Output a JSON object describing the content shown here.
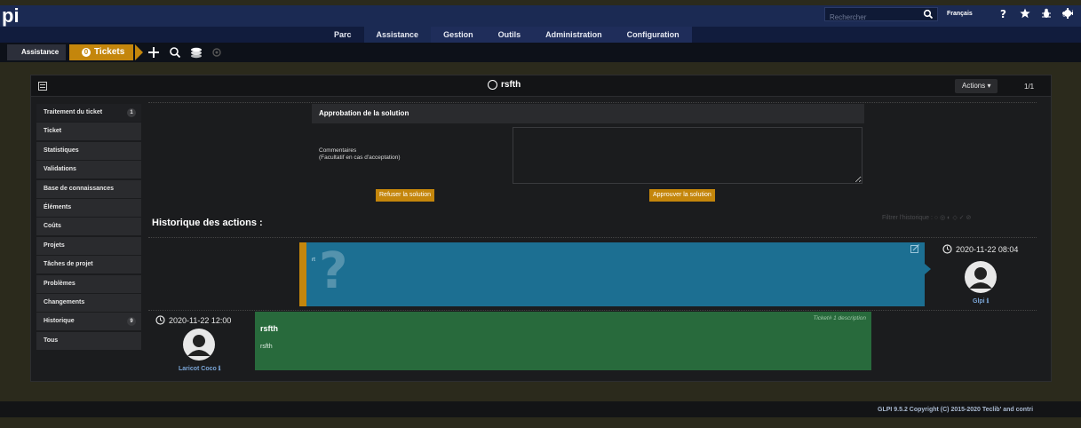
{
  "app": {
    "logo": "pi",
    "user": "glpi",
    "language": "Français"
  },
  "search": {
    "placeholder": "Rechercher"
  },
  "menu": {
    "items": [
      "Parc",
      "Assistance",
      "Gestion",
      "Outils",
      "Administration",
      "Configuration"
    ]
  },
  "breadcrumb": {
    "section": "Assistance",
    "page": "Tickets",
    "page_number": "0"
  },
  "card": {
    "title": "rsfth",
    "actions_label": "Actions",
    "pager": "1/1"
  },
  "tabs": [
    {
      "label": "Traitement du ticket",
      "badge": "1"
    },
    {
      "label": "Ticket",
      "badge": ""
    },
    {
      "label": "Statistiques",
      "badge": ""
    },
    {
      "label": "Validations",
      "badge": ""
    },
    {
      "label": "Base de connaissances",
      "badge": ""
    },
    {
      "label": "Éléments",
      "badge": ""
    },
    {
      "label": "Coûts",
      "badge": ""
    },
    {
      "label": "Projets",
      "badge": ""
    },
    {
      "label": "Tâches de projet",
      "badge": ""
    },
    {
      "label": "Problèmes",
      "badge": ""
    },
    {
      "label": "Changements",
      "badge": ""
    },
    {
      "label": "Historique",
      "badge": "9"
    },
    {
      "label": "Tous",
      "badge": ""
    }
  ],
  "approval": {
    "title": "Approbation de la solution",
    "comment_label_1": "Commentaires",
    "comment_label_2": "(Facultatif en cas d'acceptation)",
    "refuse_label": "Refuser la solution",
    "approve_label": "Approuver la solution"
  },
  "history": {
    "title": "Historique des actions :",
    "filter_label": "Filtrer l'historique :"
  },
  "followup": {
    "text": "rt",
    "date": "2020-11-22 08:04",
    "author": "Glpi"
  },
  "description": {
    "header": "Ticket# 1 description",
    "title": "rsfth",
    "body": "rsfth",
    "date": "2020-11-22 12:00",
    "author": "Laricot Coco"
  },
  "footer": {
    "text": "GLPI 9.5.2 Copyright (C) 2015-2020 Teclib' and contri"
  },
  "colors": {
    "topbar": "#1b2a53",
    "accent": "#c4860c",
    "followup": "#1c6f92",
    "description": "#286a3c"
  }
}
